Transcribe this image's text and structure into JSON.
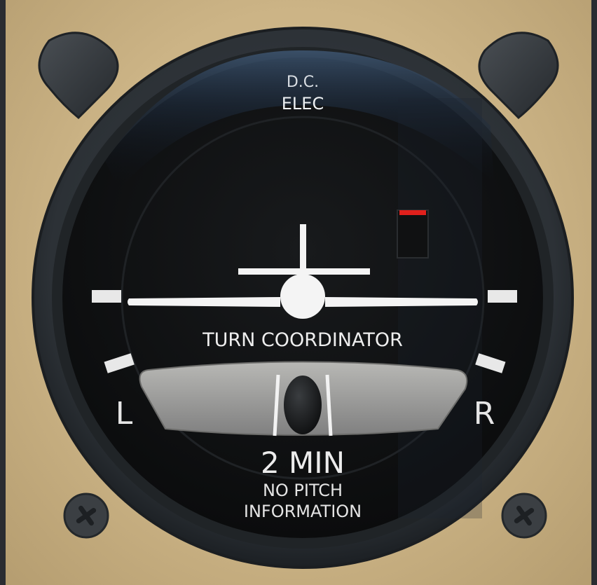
{
  "instrument": {
    "name": "TURN COORDINATOR",
    "power_source_line1": "D.C.",
    "power_source_line2": "ELEC",
    "left_mark": "L",
    "right_mark": "R",
    "rate_label": "2 MIN",
    "note_line1": "NO PITCH",
    "note_line2": "INFORMATION"
  },
  "state": {
    "bank_indication_deg": 0,
    "slip_ball_offset": 0,
    "power_flag_visible": true
  },
  "colors": {
    "panel": "#ccb486",
    "bezel": "#2b3035",
    "dial_face": "#121416",
    "markings": "#ffffff",
    "flag_red": "#e0201c",
    "inclinometer": "#9a9a98"
  },
  "icons": [
    "knob-icon",
    "screw-icon",
    "airplane-symbol-icon",
    "slip-ball-icon"
  ]
}
